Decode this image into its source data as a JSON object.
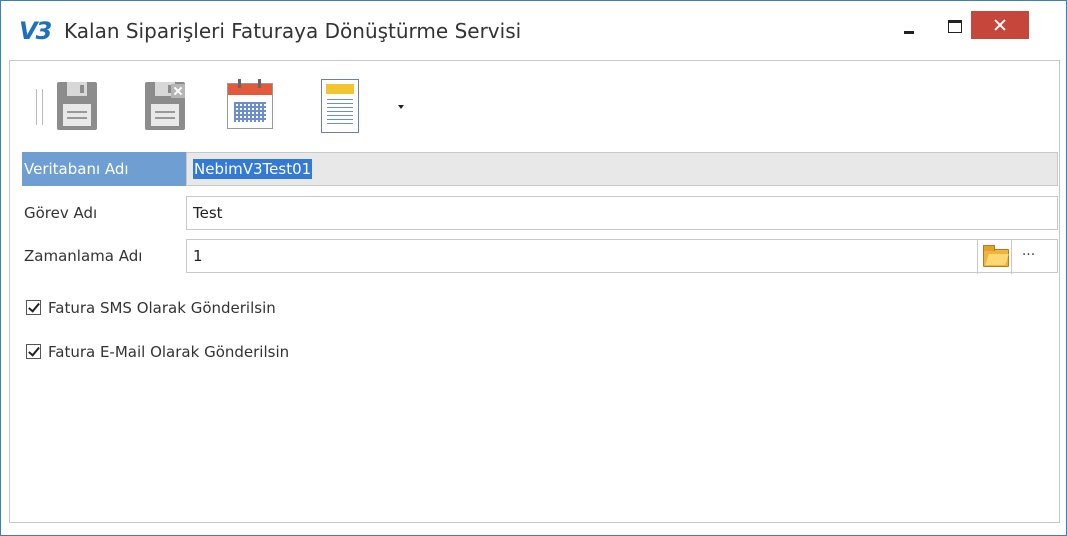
{
  "window": {
    "logo_text": "V3",
    "title": "Kalan Siparişleri Faturaya Dönüştürme Servisi"
  },
  "toolbar": {
    "buttons": [
      {
        "icon": "save-disk-icon"
      },
      {
        "icon": "discard-disk-icon"
      },
      {
        "icon": "calendar-icon"
      },
      {
        "icon": "document-icon"
      }
    ],
    "overflow_icon": "chevron-down-icon"
  },
  "form": {
    "database": {
      "label": "Veritabanı Adı",
      "value": "NebimV3Test01"
    },
    "task": {
      "label": "Görev Adı",
      "value": "Test"
    },
    "schedule": {
      "label": "Zamanlama Adı",
      "value": "1",
      "ellipsis": "···"
    }
  },
  "options": {
    "sms": {
      "label": "Fatura SMS Olarak Gönderilsin",
      "checked": true
    },
    "email": {
      "label": "Fatura E-Mail Olarak Gönderilsin",
      "checked": true
    }
  },
  "colors": {
    "accent": "#6f9fd2",
    "selection": "#3379d6",
    "close_button": "#c7463b",
    "window_border": "#3c7fb1"
  }
}
